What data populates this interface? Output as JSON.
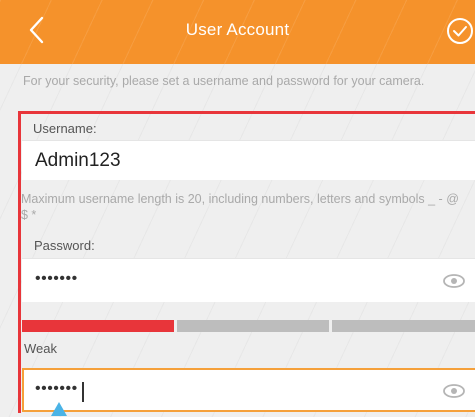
{
  "header": {
    "title": "User Account",
    "back_icon": "chevron-left-icon",
    "confirm_icon": "check-circle-icon",
    "color": "#f5922b"
  },
  "intro_text": "For your security, please set a username and password for your camera.",
  "username": {
    "label": "Username:",
    "value": "Admin123"
  },
  "username_hint": "Maximum username length is 20, including numbers, letters and symbols _ - @ $ *",
  "password": {
    "label": "Password:",
    "value": "•••••••",
    "toggle_icon": "eye-icon"
  },
  "strength": {
    "label": "Weak",
    "level": 1,
    "segments": 3,
    "active_color": "#e8353a",
    "inactive_color": "#bdbdbd"
  },
  "confirm_password": {
    "value": "•••••••",
    "toggle_icon": "eye-icon"
  }
}
